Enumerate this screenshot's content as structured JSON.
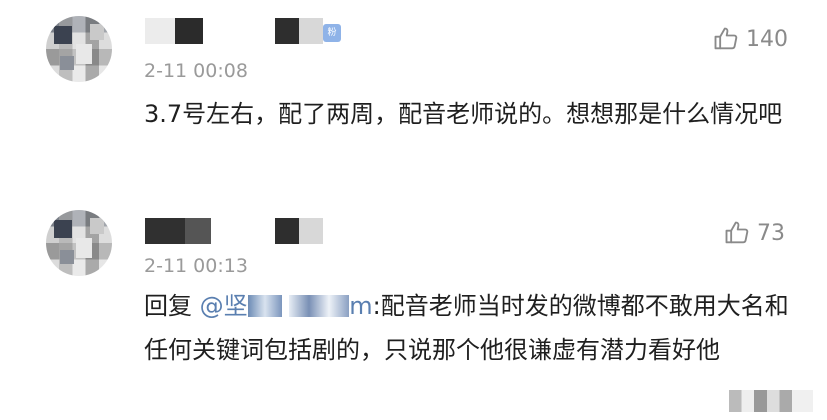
{
  "comments": [
    {
      "timestamp": "2-11 00:08",
      "like_count": "140",
      "text": "3.7号左右，配了两周，配音老师说的。想想那是什么情况吧"
    },
    {
      "timestamp": "2-11 00:13",
      "like_count": "73",
      "reply_prefix": "回复",
      "mention_start": "@坚",
      "mention_end": "m",
      "text": ":配音老师当时发的微博都不敢用大名和任何关键词包括剧的，只说那个他很谦虚有潜力看好他"
    }
  ],
  "badge_text": "粉",
  "colors": {
    "timestamp": "#9a9a9a",
    "mention": "#5a7fb0",
    "like_icon": "#8a8a8a"
  },
  "icons": [
    "thumbs-up-icon"
  ]
}
